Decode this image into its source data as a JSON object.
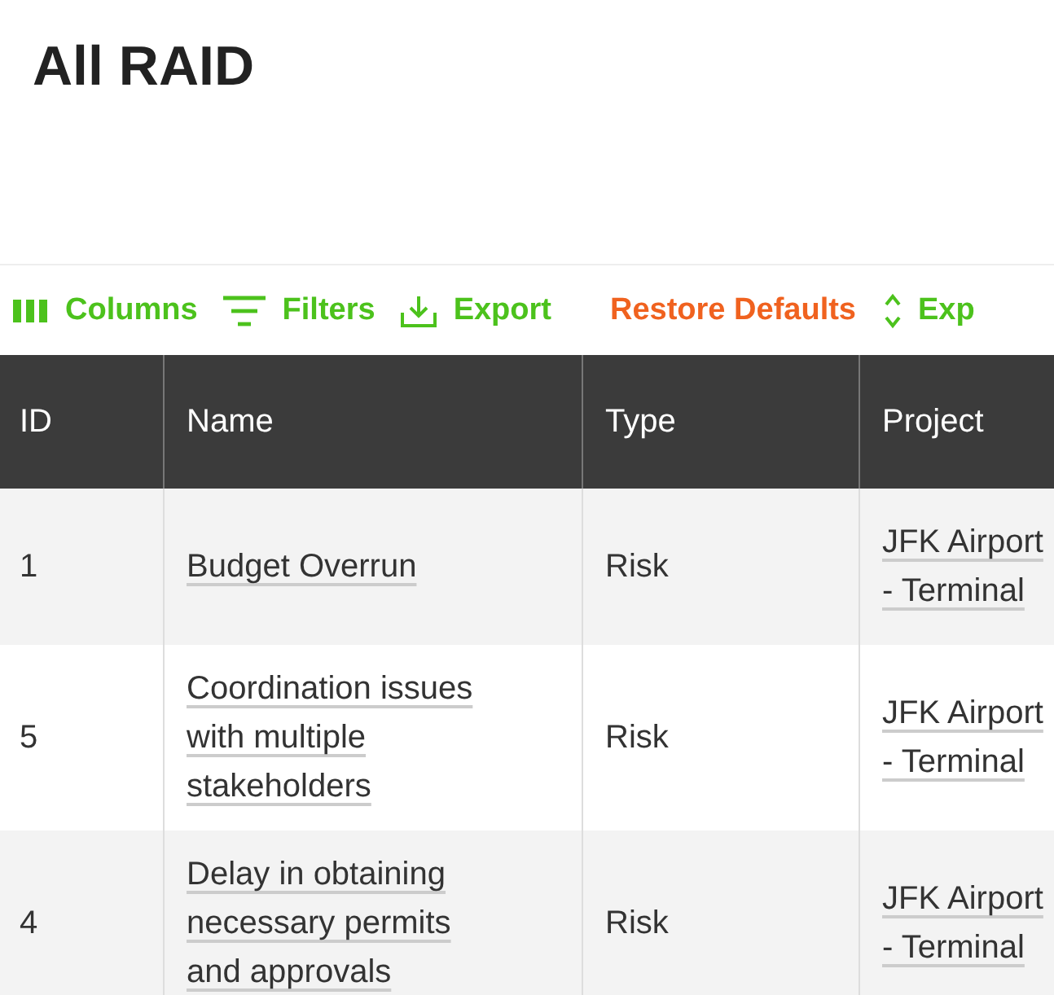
{
  "page": {
    "title": "All RAID"
  },
  "toolbar": [
    {
      "label": "Columns",
      "kind": "columns"
    },
    {
      "label": "Filters",
      "kind": "filters"
    },
    {
      "label": "Export",
      "kind": "export"
    },
    {
      "label": "Restore Defaults",
      "kind": "reset"
    },
    {
      "label": "Exp",
      "kind": "expand"
    }
  ],
  "table": {
    "columns": [
      "ID",
      "Name",
      "Type",
      "Project"
    ],
    "rows": [
      {
        "id": "1",
        "name": "Budget Overrun",
        "type": "Risk",
        "project": "JFK Airport - Terminal"
      },
      {
        "id": "5",
        "name": "Coordination issues with multiple stakeholders",
        "type": "Risk",
        "project": "JFK Airport - Terminal"
      },
      {
        "id": "4",
        "name": "Delay in obtaining necessary permits and approvals",
        "type": "Risk",
        "project": "JFK Airport - Terminal"
      }
    ]
  }
}
